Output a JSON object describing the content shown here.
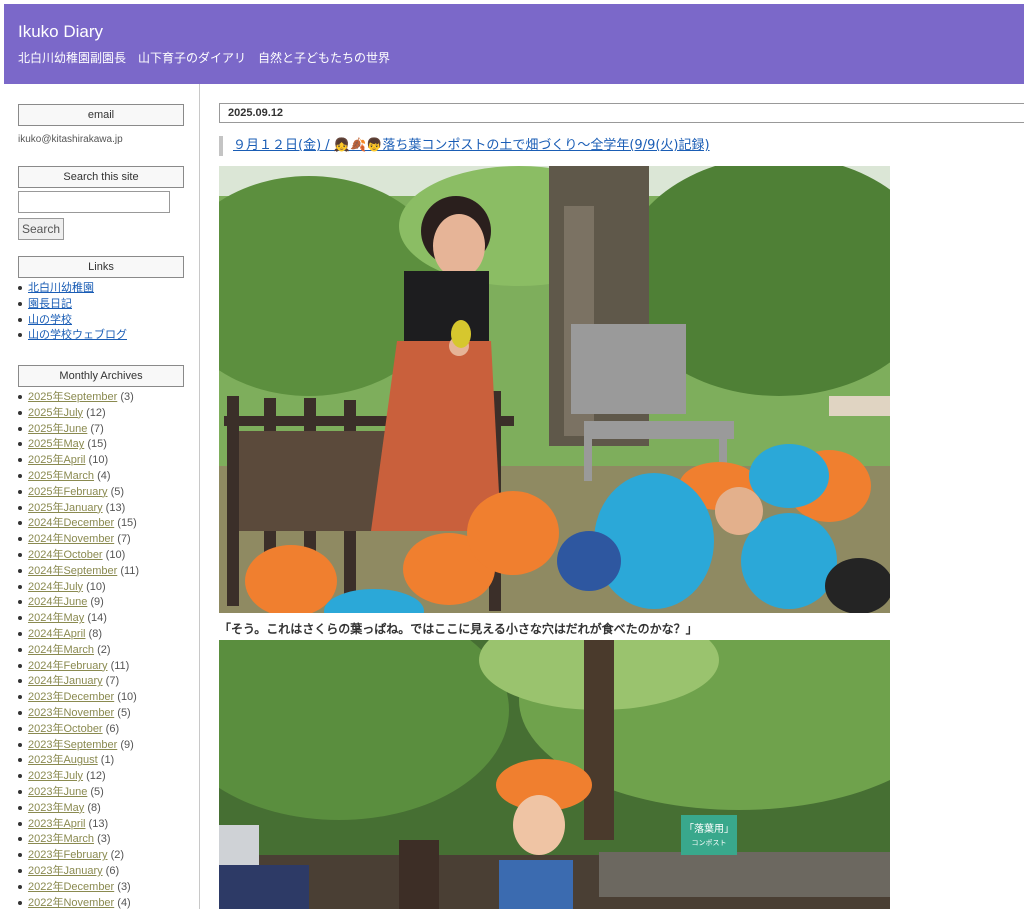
{
  "header": {
    "title": "Ikuko Diary",
    "description": "北白川幼稚園副園長　山下育子のダイアリ　自然と子どもたちの世界"
  },
  "sidebar": {
    "email": {
      "title": "email",
      "address": "ikuko@kitashirakawa.jp"
    },
    "search": {
      "title": "Search this site",
      "button": "Search",
      "value": ""
    },
    "links": {
      "title": "Links",
      "items": [
        "北白川幼稚園",
        "園長日記",
        "山の学校",
        "山の学校ウェブログ"
      ]
    },
    "archives": {
      "title": "Monthly Archives",
      "items": [
        {
          "label": "2025年September",
          "count": "(3)"
        },
        {
          "label": "2025年July",
          "count": "(12)"
        },
        {
          "label": "2025年June",
          "count": "(7)"
        },
        {
          "label": "2025年May",
          "count": "(15)"
        },
        {
          "label": "2025年April",
          "count": "(10)"
        },
        {
          "label": "2025年March",
          "count": "(4)"
        },
        {
          "label": "2025年February",
          "count": "(5)"
        },
        {
          "label": "2025年January",
          "count": "(13)"
        },
        {
          "label": "2024年December",
          "count": "(15)"
        },
        {
          "label": "2024年November",
          "count": "(7)"
        },
        {
          "label": "2024年October",
          "count": "(10)"
        },
        {
          "label": "2024年September",
          "count": "(11)"
        },
        {
          "label": "2024年July",
          "count": "(10)"
        },
        {
          "label": "2024年June",
          "count": "(9)"
        },
        {
          "label": "2024年May",
          "count": "(14)"
        },
        {
          "label": "2024年April",
          "count": "(8)"
        },
        {
          "label": "2024年March",
          "count": "(2)"
        },
        {
          "label": "2024年February",
          "count": "(11)"
        },
        {
          "label": "2024年January",
          "count": "(7)"
        },
        {
          "label": "2023年December",
          "count": "(10)"
        },
        {
          "label": "2023年November",
          "count": "(5)"
        },
        {
          "label": "2023年October",
          "count": "(6)"
        },
        {
          "label": "2023年September",
          "count": "(9)"
        },
        {
          "label": "2023年August",
          "count": "(1)"
        },
        {
          "label": "2023年July",
          "count": "(12)"
        },
        {
          "label": "2023年June",
          "count": "(5)"
        },
        {
          "label": "2023年May",
          "count": "(8)"
        },
        {
          "label": "2023年April",
          "count": "(13)"
        },
        {
          "label": "2023年March",
          "count": "(3)"
        },
        {
          "label": "2023年February",
          "count": "(2)"
        },
        {
          "label": "2023年January",
          "count": "(6)"
        },
        {
          "label": "2022年December",
          "count": "(3)"
        },
        {
          "label": "2022年November",
          "count": "(4)"
        }
      ]
    }
  },
  "entry": {
    "date": "2025.09.12",
    "title": "９月１２日(金) / 👧🍂👦落ち葉コンポストの土で畑づくり〜全学年(9/9(火)記録)",
    "caption1": "「そう。これはさくらの葉っぱね。ではここに見える小さな穴はだれが食べたのかな？」",
    "sign_text": "「落葉用」",
    "sign_sub": "コンポスト"
  }
}
